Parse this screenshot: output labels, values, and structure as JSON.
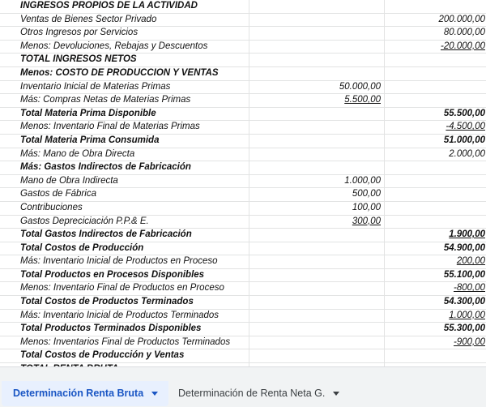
{
  "rows": [
    {
      "label": "INGRESOS PROPIOS DE LA ACTIVIDAD",
      "col_b": "",
      "col_c": "",
      "bold": true
    },
    {
      "label": "Ventas de Bienes Sector Privado",
      "col_b": "",
      "col_c": "200.000,00"
    },
    {
      "label": "Otros Ingresos por Servicios",
      "col_b": "",
      "col_c": "80.000,00"
    },
    {
      "label": "Menos: Devoluciones, Rebajas y Descuentos",
      "col_b": "",
      "col_c": "-20.000,00",
      "u_c": true
    },
    {
      "label": "TOTAL INGRESOS NETOS",
      "col_b": "",
      "col_c": "",
      "bold": true
    },
    {
      "label": "Menos: COSTO DE PRODUCCION Y VENTAS",
      "col_b": "",
      "col_c": "",
      "bold": true
    },
    {
      "label": "Inventario Inicial de Materias Primas",
      "col_b": "50.000,00",
      "col_c": ""
    },
    {
      "label": "Más: Compras Netas de Materias Primas",
      "col_b": "5.500,00",
      "col_c": "",
      "u_b": true
    },
    {
      "label": "Total Materia Prima Disponible",
      "col_b": "",
      "col_c": "55.500,00",
      "bold": true
    },
    {
      "label": "Menos: Inventario Final de Materias Primas",
      "col_b": "",
      "col_c": "-4.500,00",
      "u_c": true
    },
    {
      "label": "Total Materia Prima Consumida",
      "col_b": "",
      "col_c": "51.000,00",
      "bold": true
    },
    {
      "label": "Más: Mano de Obra Directa",
      "col_b": "",
      "col_c": "2.000,00"
    },
    {
      "label": "Más: Gastos Indirectos de Fabricación",
      "col_b": "",
      "col_c": "",
      "bold": true
    },
    {
      "label": "Mano de Obra Indirecta",
      "col_b": "1.000,00",
      "col_c": ""
    },
    {
      "label": "Gastos de Fábrica",
      "col_b": "500,00",
      "col_c": ""
    },
    {
      "label": "Contribuciones",
      "col_b": "100,00",
      "col_c": ""
    },
    {
      "label": "Gastos Depreciciación P.P.& E.",
      "col_b": "300,00",
      "col_c": "",
      "u_b": true
    },
    {
      "label": "Total Gastos Indirectos de Fabricación",
      "col_b": "",
      "col_c": "1.900,00",
      "bold": true,
      "u_c": true
    },
    {
      "label": "Total Costos de Producción",
      "col_b": "",
      "col_c": "54.900,00",
      "bold": true
    },
    {
      "label": "Más: Inventario Inicial de Productos en Proceso",
      "col_b": "",
      "col_c": "200,00",
      "u_c": true
    },
    {
      "label": "Total Productos en Procesos Disponibles",
      "col_b": "",
      "col_c": "55.100,00",
      "bold": true
    },
    {
      "label": "Menos: Inventario Final de Productos en Proceso",
      "col_b": "",
      "col_c": "-800,00",
      "u_c": true
    },
    {
      "label": "Total Costos de Productos Terminados",
      "col_b": "",
      "col_c": "54.300,00",
      "bold": true
    },
    {
      "label": "Más: Inventario Inicial de Productos Terminados",
      "col_b": "",
      "col_c": "1.000,00",
      "u_c": true
    },
    {
      "label": "Total Productos Terminados Disponibles",
      "col_b": "",
      "col_c": "55.300,00",
      "bold": true
    },
    {
      "label": "Menos: Inventarios Final de Productos Terminados",
      "col_b": "",
      "col_c": "-900,00",
      "u_c": true
    },
    {
      "label": "Total Costos de Producción y Ventas",
      "col_b": "",
      "col_c": "",
      "bold": true
    },
    {
      "label": "TOTAL RENTA BRUTA",
      "col_b": "",
      "col_c": "",
      "bold": true
    }
  ],
  "tabs": [
    {
      "label": "Determinación Renta Bruta",
      "active": true
    },
    {
      "label": "Determinación de Renta Neta G.",
      "active": false
    }
  ],
  "colors": {
    "active_tab_bg": "#e8f0fe",
    "active_tab_text": "#1a56c4",
    "gridline": "#e2e3e3"
  },
  "icons": {
    "tab_menu": "caret-down-icon"
  }
}
